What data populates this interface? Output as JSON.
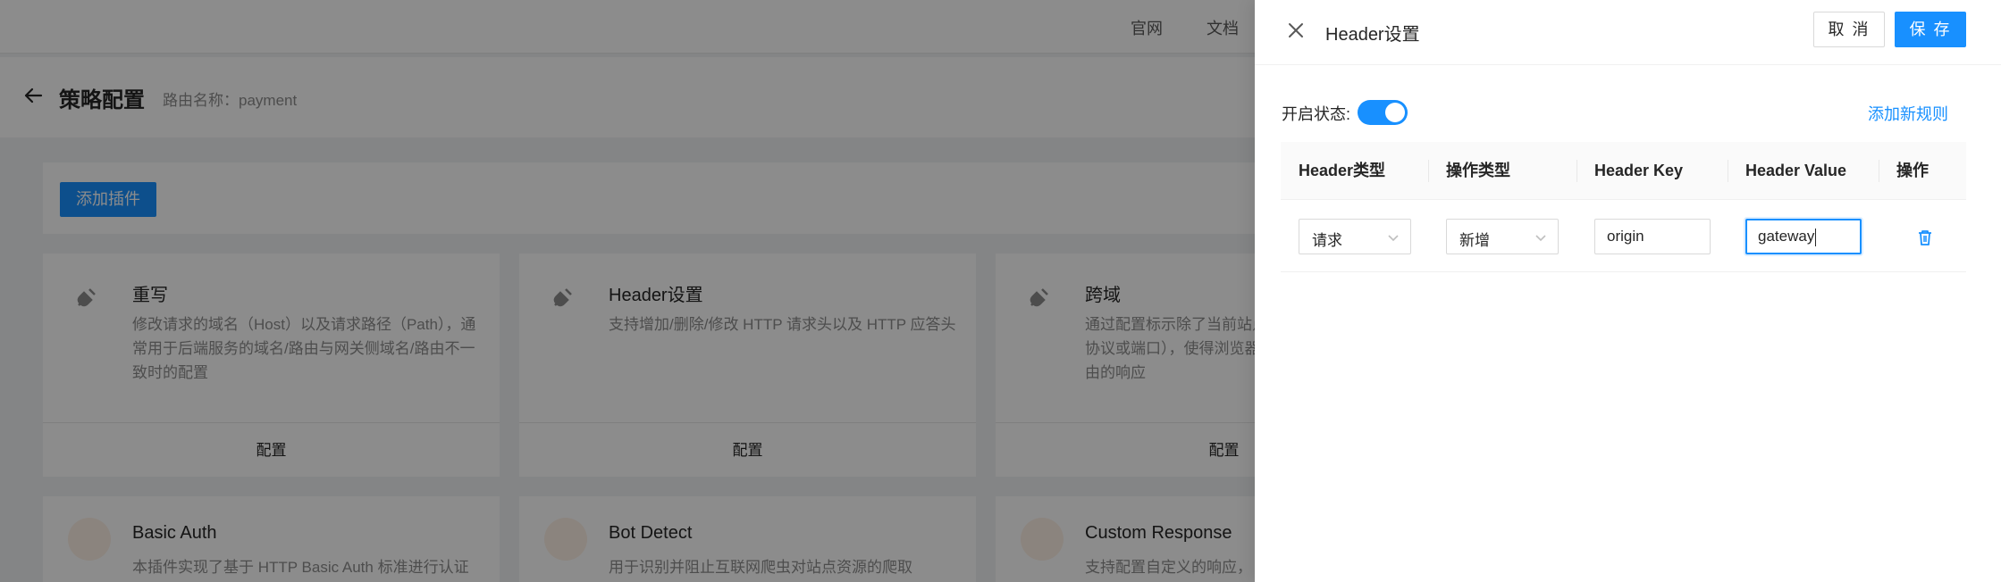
{
  "topbar": {
    "links": [
      "官网",
      "文档"
    ]
  },
  "page": {
    "title": "策略配置",
    "route_name": "路由名称：payment"
  },
  "toolbar": {
    "add_plugin_label": "添加插件"
  },
  "plugins": [
    {
      "title": "重写",
      "desc": "修改请求的域名（Host）以及请求路径（Path），通常用于后端服务的域名/路由与网关侧域名/路由不一致时的配置",
      "action": "配置"
    },
    {
      "title": "Header设置",
      "desc": "支持增加/删除/修改 HTTP 请求头以及 HTTP 应答头",
      "action": "配置"
    },
    {
      "title": "跨域",
      "desc": "通过配置标示除了当前站点以外的其他源（域名、协议或端口），使得浏览器允许这些源访问加载该路由的响应",
      "action": "配置"
    },
    {
      "title": "Basic Auth",
      "desc": "本插件实现了基于 HTTP Basic Auth 标准进行认证"
    },
    {
      "title": "Bot Detect",
      "desc": "用于识别并阻止互联网爬虫对站点资源的爬取"
    },
    {
      "title": "Custom Response",
      "desc": "支持配置自定义的响应，"
    }
  ],
  "drawer": {
    "title": "Header设置",
    "cancel_label": "取 消",
    "save_label": "保 存",
    "status_label": "开启状态:",
    "enabled": true,
    "add_rule_label": "添加新规则",
    "columns": [
      "Header类型",
      "操作类型",
      "Header Key",
      "Header Value",
      "操作"
    ],
    "rows": [
      {
        "header_type": "请求",
        "op_type": "新增",
        "key": "origin",
        "value": "gateway"
      }
    ]
  },
  "colors": {
    "primary": "#1890ff",
    "mask": "rgba(0,0,0,0.45)"
  }
}
